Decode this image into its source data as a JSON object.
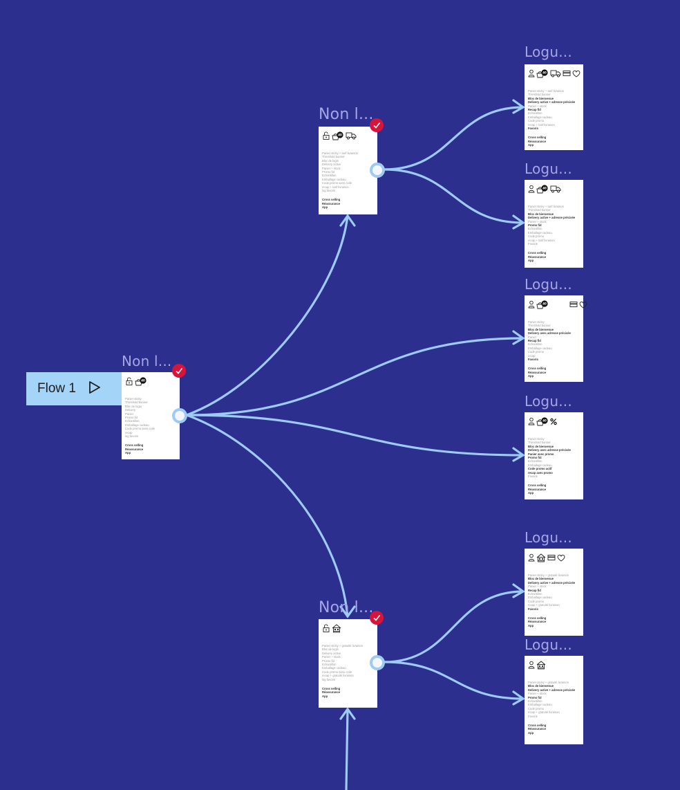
{
  "canvas": {
    "background": "#2d2f8f",
    "connector_color": "#9dcbf6",
    "check_color": "#d7153a"
  },
  "flow_start": {
    "label": "Flow 1",
    "icon": "play-outline-icon"
  },
  "frames": [
    {
      "id": "root",
      "title": "Non l...",
      "checked": true,
      "icons": [
        "lock-open-icon",
        "basket-badge-icon"
      ],
      "badge": "40",
      "lines": [
        {
          "t": "Panier sticky",
          "b": false
        },
        {
          "t": "Threshold banner",
          "b": false
        },
        {
          "t": "Bloc de login",
          "b": false
        },
        {
          "t": "Delivery",
          "b": false
        },
        {
          "t": "Panier",
          "b": false
        },
        {
          "t": "Promo fid",
          "b": false
        },
        {
          "t": "Echantillon",
          "b": false
        },
        {
          "t": "Emballage cadeau",
          "b": false
        },
        {
          "t": "Code promo sans code",
          "b": false
        },
        {
          "t": "recap",
          "b": false
        },
        {
          "t": "log favoris",
          "b": false
        }
      ],
      "footer": [
        "Cross selling",
        "Réassurance",
        "App"
      ]
    },
    {
      "id": "top-mid",
      "title": "Non l...",
      "checked": true,
      "icons": [
        "lock-open-icon",
        "basket-badge-icon",
        "truck-icon"
      ],
      "badge": "40",
      "lines": [
        {
          "t": "Panier sticky + tarif livraison",
          "b": false
        },
        {
          "t": "Threshold banner",
          "b": false
        },
        {
          "t": "Bloc de login",
          "b": false
        },
        {
          "t": "Delivery active",
          "b": false
        },
        {
          "t": "Panier + stock",
          "b": false
        },
        {
          "t": "Promo fid",
          "b": false
        },
        {
          "t": "Echantillon",
          "b": false
        },
        {
          "t": "Emballage cadeau",
          "b": false
        },
        {
          "t": "Code promo sans code",
          "b": false
        },
        {
          "t": "recap + tarif livraison",
          "b": false
        },
        {
          "t": "log favoris",
          "b": false
        }
      ],
      "footer": [
        "Cross selling",
        "Réassurance",
        "App"
      ]
    },
    {
      "id": "bottom-mid",
      "title": "Non l...",
      "checked": true,
      "icons": [
        "lock-open-icon",
        "store-icon"
      ],
      "badge": "",
      "lines": [
        {
          "t": "Panier sticky + gratuité livraison",
          "b": false
        },
        {
          "t": "Bloc de login",
          "b": false
        },
        {
          "t": "Delivery active",
          "b": false
        },
        {
          "t": "Panier + stock",
          "b": false
        },
        {
          "t": "Promo fid",
          "b": false
        },
        {
          "t": "Echantillon",
          "b": false
        },
        {
          "t": "Emballage cadeau",
          "b": false
        },
        {
          "t": "Code promo sans code",
          "b": false
        },
        {
          "t": "recap + gratuité livraison",
          "b": false
        },
        {
          "t": "log favoris",
          "b": false
        }
      ],
      "footer": [
        "Cross selling",
        "Réassurance",
        "App"
      ]
    },
    {
      "id": "r1",
      "title": "Logu...",
      "checked": false,
      "icons": [
        "user-icon",
        "basket-badge-icon",
        "truck-icon",
        "credit-card-icon",
        "heart-icon"
      ],
      "badge": "40",
      "lines": [
        {
          "t": "Panier sticky + tarif livraison",
          "b": false
        },
        {
          "t": "Threshold banner",
          "b": false
        },
        {
          "t": "Bloc de bienvenue",
          "b": true
        },
        {
          "t": "Delivery active + adresse précisée",
          "b": true
        },
        {
          "t": "Panier + stock",
          "b": false
        },
        {
          "t": "Recap fid",
          "b": true
        },
        {
          "t": "Echantillon",
          "b": false
        },
        {
          "t": "Emballage cadeau",
          "b": false
        },
        {
          "t": "Code promo",
          "b": false
        },
        {
          "t": "recap + tarif livraison",
          "b": false
        },
        {
          "t": "Favoris",
          "b": true
        }
      ],
      "footer": [
        "Cross selling",
        "Réassurance",
        "App"
      ]
    },
    {
      "id": "r2",
      "title": "Logu...",
      "checked": false,
      "icons": [
        "user-icon",
        "basket-badge-icon",
        "truck-icon"
      ],
      "badge": "40",
      "lines": [
        {
          "t": "Panier sticky + tarif livraison",
          "b": false
        },
        {
          "t": "Threshold banner",
          "b": false
        },
        {
          "t": "Bloc de bienvenue",
          "b": true
        },
        {
          "t": "Delivery active + adresse précisée",
          "b": true
        },
        {
          "t": "Panier + stock",
          "b": false
        },
        {
          "t": "Promo fid",
          "b": true
        },
        {
          "t": "Echantillon",
          "b": false
        },
        {
          "t": "Emballage cadeau",
          "b": false
        },
        {
          "t": "Code promo",
          "b": false
        },
        {
          "t": "recap + tarif livraison",
          "b": false
        },
        {
          "t": "Favoris",
          "b": false
        }
      ],
      "footer": [
        "Cross selling",
        "Réassurance",
        "App"
      ]
    },
    {
      "id": "r3",
      "title": "Logu...",
      "checked": false,
      "icons": [
        "user-icon",
        "basket-badge-icon",
        "spacer",
        "credit-card-icon",
        "heart-icon"
      ],
      "badge": "40",
      "lines": [
        {
          "t": "Panier sticky",
          "b": false
        },
        {
          "t": "Threshold banner",
          "b": false
        },
        {
          "t": "Bloc de bienvenue",
          "b": true
        },
        {
          "t": "Delivery avec adresse précisée",
          "b": true
        },
        {
          "t": "Panier",
          "b": false
        },
        {
          "t": "Recap fid",
          "b": true
        },
        {
          "t": "Echantillon",
          "b": false
        },
        {
          "t": "Emballage cadeau",
          "b": false
        },
        {
          "t": "Code promo",
          "b": false
        },
        {
          "t": "recap",
          "b": false
        },
        {
          "t": "Favoris",
          "b": true
        }
      ],
      "footer": [
        "Cross selling",
        "Réassurance",
        "App"
      ]
    },
    {
      "id": "r4",
      "title": "Logu...",
      "checked": false,
      "icons": [
        "user-icon",
        "basket-badge-icon",
        "percent-icon"
      ],
      "badge": "40",
      "lines": [
        {
          "t": "Panier sticky",
          "b": false
        },
        {
          "t": "Threshold banner",
          "b": false
        },
        {
          "t": "Bloc de bienvenue",
          "b": true
        },
        {
          "t": "Delivery avec adresse précisée",
          "b": true
        },
        {
          "t": "Panier avec promo",
          "b": true
        },
        {
          "t": "Promo fid",
          "b": true
        },
        {
          "t": "Echantillon",
          "b": false
        },
        {
          "t": "Emballage cadeau",
          "b": false
        },
        {
          "t": "Code promo actif",
          "b": true
        },
        {
          "t": "recap avec promo",
          "b": true
        },
        {
          "t": "Favoris",
          "b": false
        }
      ],
      "footer": [
        "Cross selling",
        "Réassurance",
        "App"
      ]
    },
    {
      "id": "r5",
      "title": "Logu...",
      "checked": false,
      "icons": [
        "user-icon",
        "store-icon",
        "credit-card-icon",
        "heart-icon"
      ],
      "badge": "",
      "lines": [
        {
          "t": "Panier sticky + gratuité livraison",
          "b": false
        },
        {
          "t": "Bloc de bienvenue",
          "b": true
        },
        {
          "t": "Delivery active + adresse précisée",
          "b": true
        },
        {
          "t": "Panier + stock",
          "b": false
        },
        {
          "t": "Recap fid",
          "b": true
        },
        {
          "t": "Echantillon",
          "b": false
        },
        {
          "t": "Emballage cadeau",
          "b": false
        },
        {
          "t": "Code promo",
          "b": false
        },
        {
          "t": "recap + gratuité livraison",
          "b": false
        },
        {
          "t": "Favoris",
          "b": true
        }
      ],
      "footer": [
        "Cross selling",
        "Réassurance",
        "App"
      ]
    },
    {
      "id": "r6",
      "title": "Logu...",
      "checked": false,
      "icons": [
        "user-icon",
        "store-icon"
      ],
      "badge": "",
      "lines": [
        {
          "t": "Panier sticky + gratuité livraison",
          "b": false
        },
        {
          "t": "Bloc de bienvenue",
          "b": true
        },
        {
          "t": "Delivery active + adresse précisée",
          "b": true
        },
        {
          "t": "Panier + stock",
          "b": false
        },
        {
          "t": "Promo fid",
          "b": true
        },
        {
          "t": "Echantillon",
          "b": false
        },
        {
          "t": "Emballage cadeau",
          "b": false
        },
        {
          "t": "Code promo",
          "b": false
        },
        {
          "t": "recap + gratuité livraison",
          "b": false
        },
        {
          "t": "Favoris",
          "b": false
        }
      ],
      "footer": [
        "Cross selling",
        "Réassurance",
        "App"
      ]
    }
  ],
  "connections": [
    {
      "from": "root",
      "to": "top-mid"
    },
    {
      "from": "root",
      "to": "r3"
    },
    {
      "from": "root",
      "to": "r4"
    },
    {
      "from": "root",
      "to": "bottom-mid"
    },
    {
      "from": "top-mid",
      "to": "r1"
    },
    {
      "from": "top-mid",
      "to": "r2"
    },
    {
      "from": "bottom-mid",
      "to": "r5"
    },
    {
      "from": "bottom-mid",
      "to": "r6"
    },
    {
      "from": "offscreen-below",
      "to": "bottom-mid"
    }
  ]
}
